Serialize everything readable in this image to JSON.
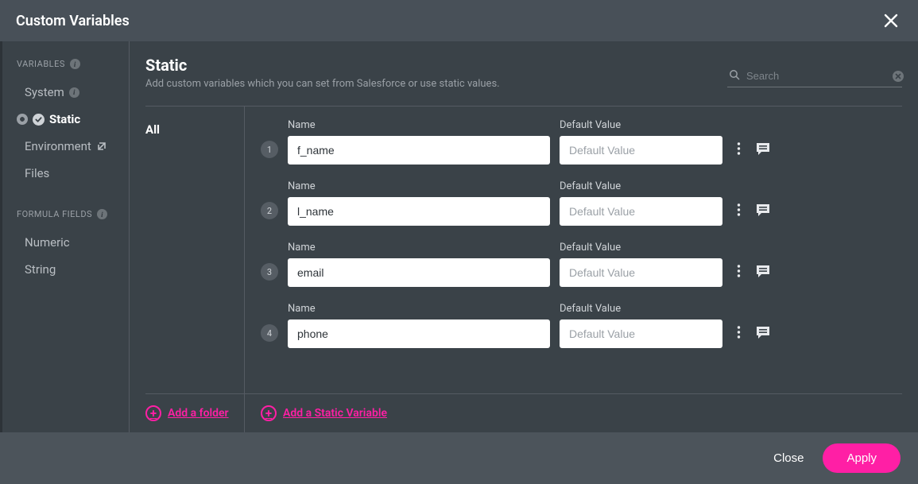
{
  "header": {
    "title": "Custom Variables"
  },
  "sidebar": {
    "sections": [
      {
        "label": "VARIABLES",
        "items": [
          {
            "label": "System",
            "info": true
          },
          {
            "label": "Static",
            "active": true
          },
          {
            "label": "Environment",
            "external": true
          },
          {
            "label": "Files"
          }
        ]
      },
      {
        "label": "FORMULA FIELDS",
        "items": [
          {
            "label": "Numeric"
          },
          {
            "label": "String"
          }
        ]
      }
    ]
  },
  "main": {
    "title": "Static",
    "subtitle": "Add custom variables which you can set from Salesforce or use static values."
  },
  "search": {
    "placeholder": "Search"
  },
  "folder": {
    "all_label": "All"
  },
  "fields": {
    "name_label": "Name",
    "value_label": "Default Value",
    "value_placeholder": "Default Value"
  },
  "variables": [
    {
      "num": "1",
      "name": "f_name",
      "value": ""
    },
    {
      "num": "2",
      "name": "l_name",
      "value": ""
    },
    {
      "num": "3",
      "name": "email",
      "value": ""
    },
    {
      "num": "4",
      "name": "phone",
      "value": ""
    }
  ],
  "actions": {
    "add_folder": "Add a folder",
    "add_variable": "Add a Static Variable"
  },
  "bottom": {
    "close": "Close",
    "apply": "Apply"
  }
}
